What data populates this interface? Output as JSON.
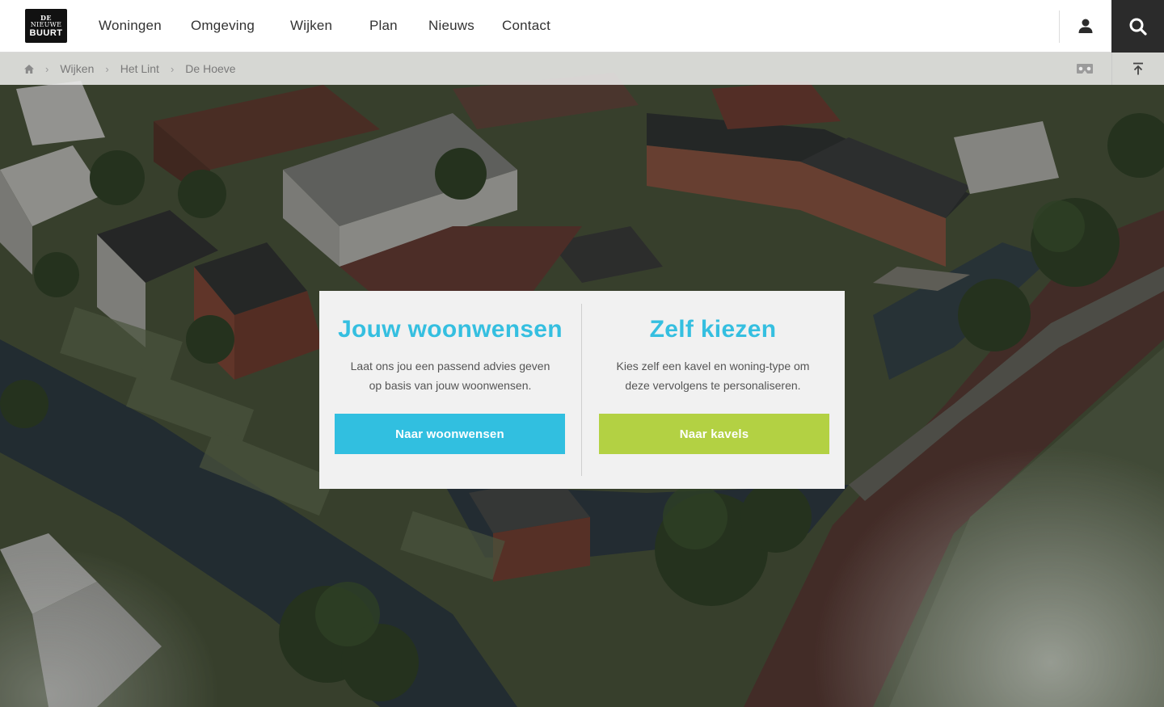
{
  "brand": {
    "logo_line1": "DE",
    "logo_line2": "NIEUWE",
    "logo_line3": "BUURT"
  },
  "nav": {
    "items": [
      {
        "label": "Woningen"
      },
      {
        "label": "Omgeving"
      },
      {
        "label": "Wijken"
      },
      {
        "label": "Plan"
      },
      {
        "label": "Nieuws"
      },
      {
        "label": "Contact"
      }
    ],
    "icons": {
      "account": "user-icon",
      "search": "search-icon"
    }
  },
  "breadcrumb": {
    "home_icon": "home-icon",
    "items": [
      {
        "label": "Wijken"
      },
      {
        "label": "Het Lint"
      },
      {
        "label": "De Hoeve"
      }
    ],
    "separator": "›",
    "right_icons": {
      "vr": "vr-headset-icon",
      "to_top": "arrow-to-top-icon"
    }
  },
  "panel": {
    "left": {
      "title": "Jouw woonwensen",
      "text": "Laat ons jou een passend advies geven op basis van jouw woonwensen.",
      "button": "Naar woonwensen"
    },
    "right": {
      "title": "Zelf kiezen",
      "text": "Kies zelf een kavel en woning-type om deze vervolgens te personaliseren.",
      "button": "Naar kavels"
    }
  },
  "colors": {
    "accent_blue": "#31bfe0",
    "accent_green": "#b3d143",
    "search_bg": "#2b2b2b"
  }
}
